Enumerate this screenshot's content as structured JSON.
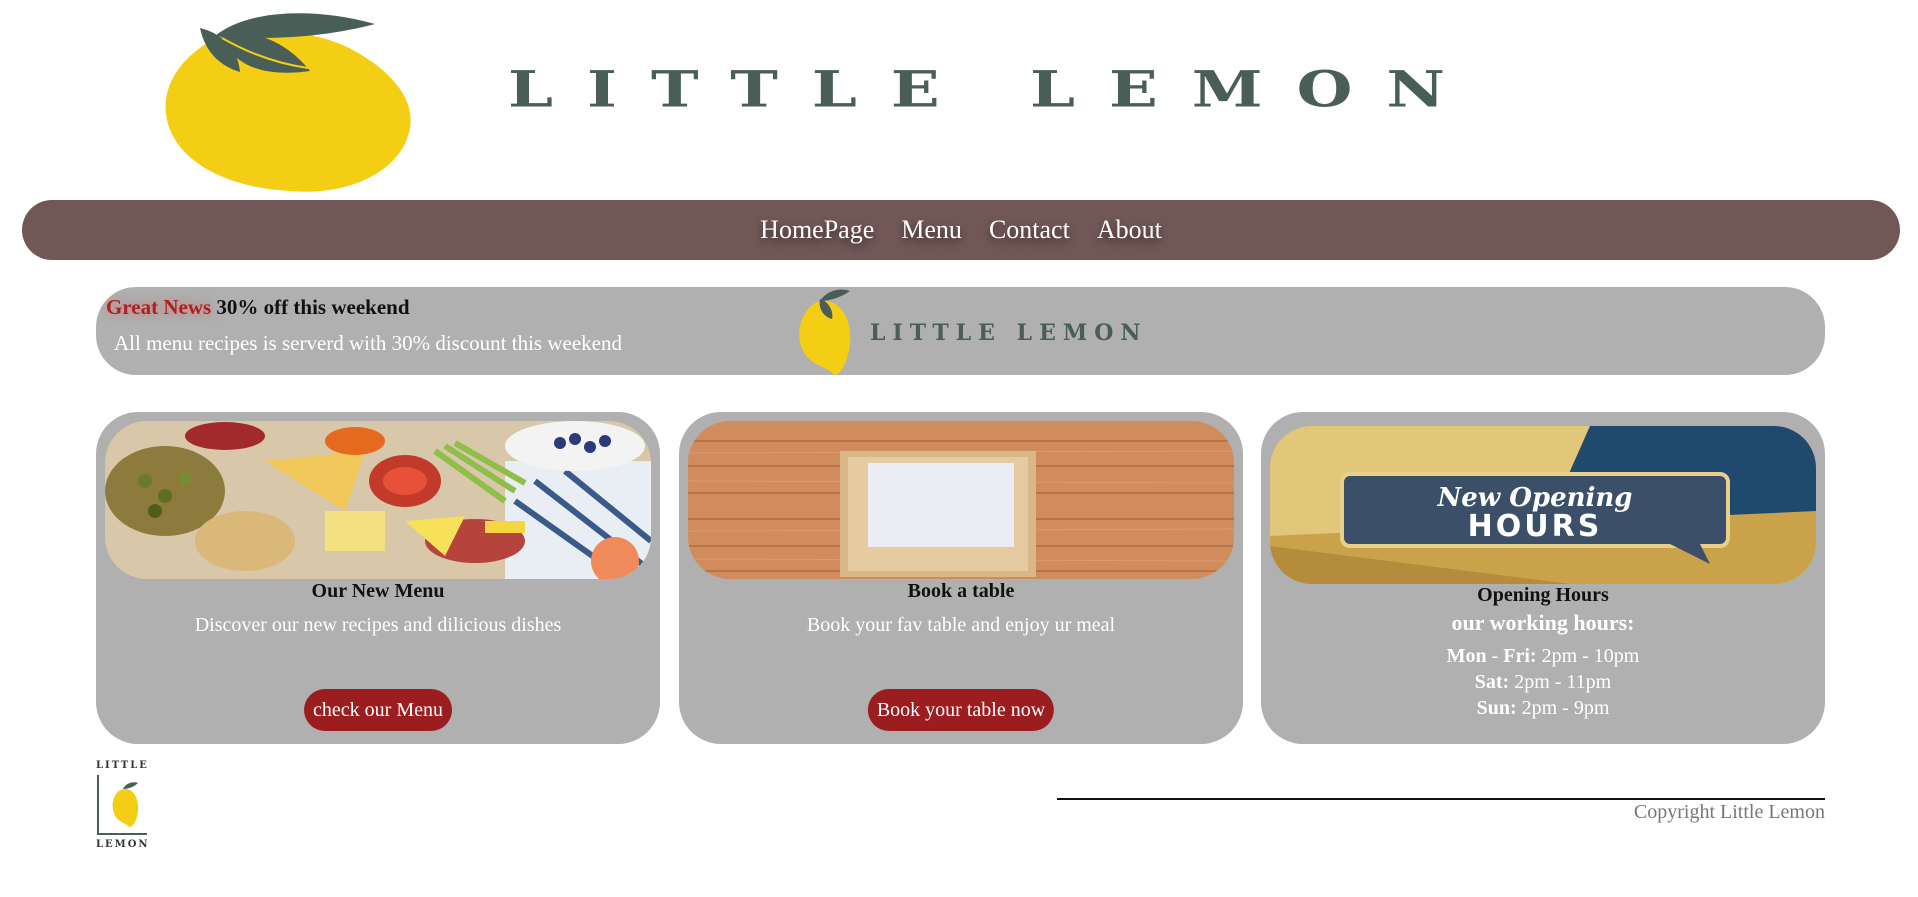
{
  "header": {
    "brand": "LITTLE LEMON",
    "logo_icon": "lemon-icon"
  },
  "nav": {
    "items": [
      {
        "label": "HomePage"
      },
      {
        "label": "Menu"
      },
      {
        "label": "Contact"
      },
      {
        "label": "About"
      }
    ]
  },
  "banner": {
    "highlight": "Great News",
    "headline": " 30% off this weekend",
    "text": "All menu recipes is serverd with 30% discount this weekend",
    "brand": "LITTLE LEMON"
  },
  "cards": [
    {
      "title": "Our New Menu",
      "text": "Discover our new recipes and dilicious dishes",
      "button": "check our Menu",
      "image": "charcuterie-board-image"
    },
    {
      "title": "Book a table",
      "text": "Book your fav table and enjoy ur meal",
      "button": "Book your table now",
      "image": "wooden-table-frame-image"
    },
    {
      "title": "Opening Hours",
      "subtitle": "our working hours:",
      "image": "new-opening-hours-image",
      "image_text": {
        "line1": "New Opening",
        "line2": "HOURS"
      },
      "hours": [
        {
          "day": "Mon",
          "sep": " - ",
          "day2": "Fri:",
          "time": " 2pm - 10pm"
        },
        {
          "day": "Sat:",
          "time": " 2pm - 11pm"
        },
        {
          "day": "Sun:",
          "time": " 2pm - 9pm"
        }
      ]
    }
  ],
  "footer": {
    "logo_top": "LITTLE",
    "logo_bottom": "LEMON",
    "copyright": "Copyright Little Lemon"
  },
  "colors": {
    "brand_green": "#495e57",
    "lemon_yellow": "#f4ce14",
    "nav_bg": "#725757",
    "card_bg": "#b0b0b0",
    "button_bg": "#9b1d20",
    "highlight_red": "#b01f1f"
  }
}
